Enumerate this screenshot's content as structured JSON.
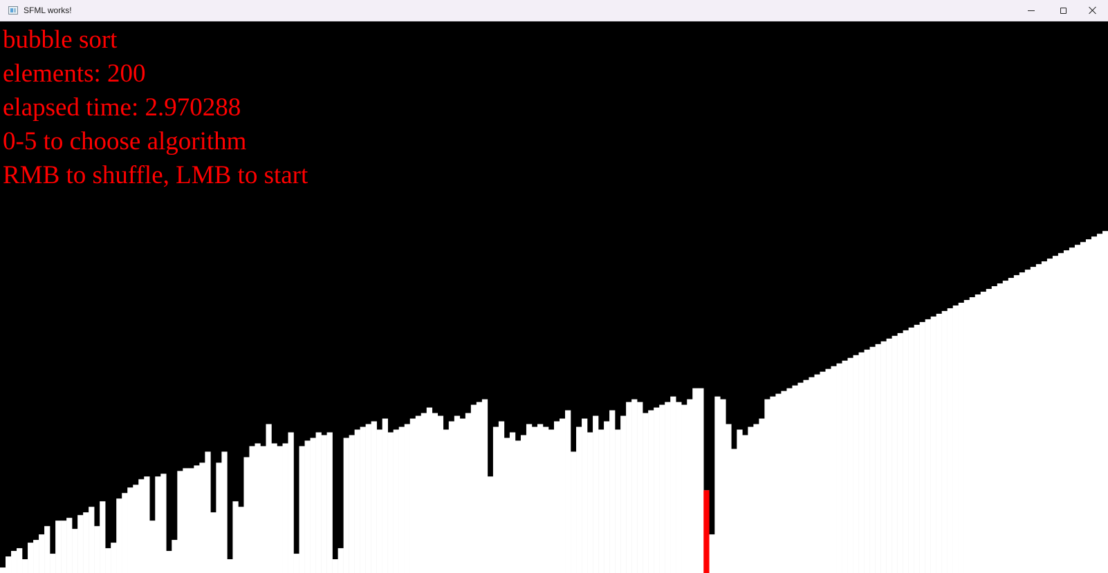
{
  "window": {
    "title": "SFML works!",
    "controls": {
      "minimize_icon": "minimize-icon",
      "maximize_icon": "maximize-icon",
      "close_icon": "close-icon"
    }
  },
  "hud": {
    "algorithm": "bubble sort",
    "elements": "elements: 200",
    "elapsed": "elapsed time: 2.970288",
    "hint_algorithm": "0-5 to choose algorithm",
    "hint_controls": "RMB to shuffle, LMB to start"
  },
  "visualization": {
    "element_count": 200,
    "max_value": 200,
    "bar_color": "#ffffff",
    "background_color": "#000000",
    "highlight_color": "#ff0000",
    "highlight_index": 127,
    "highlight_value": 30,
    "values": [
      2,
      6,
      8,
      9,
      5,
      11,
      12,
      14,
      17,
      7,
      19,
      19,
      20,
      16,
      21,
      22,
      24,
      17,
      26,
      9,
      11,
      27,
      29,
      31,
      32,
      34,
      35,
      19,
      35,
      36,
      8,
      12,
      37,
      38,
      38,
      39,
      40,
      44,
      22,
      40,
      44,
      5,
      26,
      24,
      42,
      46,
      47,
      46,
      54,
      47,
      46,
      47,
      51,
      7,
      46,
      48,
      49,
      51,
      50,
      51,
      5,
      9,
      49,
      50,
      52,
      53,
      54,
      55,
      52,
      56,
      51,
      52,
      53,
      54,
      56,
      57,
      58,
      60,
      58,
      57,
      52,
      55,
      57,
      56,
      58,
      61,
      62,
      63,
      35,
      53,
      55,
      49,
      51,
      48,
      50,
      54,
      53,
      54,
      53,
      52,
      55,
      56,
      59,
      44,
      53,
      56,
      51,
      57,
      52,
      55,
      59,
      52,
      57,
      62,
      63,
      62,
      58,
      59,
      60,
      61,
      62,
      64,
      62,
      61,
      63,
      67,
      67,
      30,
      14,
      64,
      63,
      54,
      45,
      52,
      50,
      53,
      54,
      56,
      63,
      64,
      65,
      66,
      67,
      68,
      69,
      70,
      71,
      72,
      73,
      74,
      75,
      76,
      77,
      78,
      79,
      80,
      81,
      82,
      83,
      84,
      85,
      86,
      87,
      88,
      89,
      90,
      91,
      92,
      93,
      94,
      95,
      96,
      97,
      98,
      99,
      100,
      101,
      102,
      103,
      104,
      105,
      106,
      107,
      108,
      109,
      110,
      111,
      112,
      113,
      114,
      115,
      116,
      117,
      118,
      119,
      120,
      121,
      122,
      123,
      124
    ]
  }
}
